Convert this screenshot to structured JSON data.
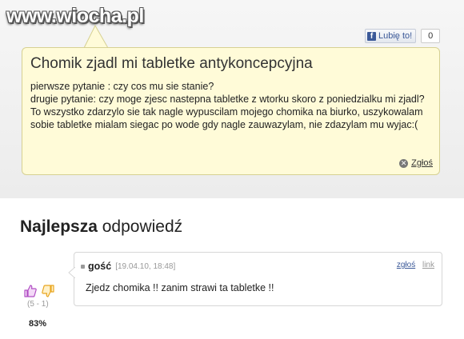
{
  "watermark": "www.wiocha.pl",
  "like": {
    "icon": "facebook-icon",
    "label": "Lubię to!",
    "count": "0"
  },
  "question": {
    "title": "Chomik zjadl mi tabletke antykoncepcyjna",
    "lines": [
      "pierwsze pytanie : czy cos mu sie stanie?",
      "drugie pytanie: czy moge zjesc nastepna tabletke z wtorku skoro z poniedzialku mi zjadl?",
      "To wszystko zdarzylo sie tak nagle wypuscilam mojego chomika na biurko, uszykowalam sobie tabletke mialam siegac po wode gdy nagle zauwazylam, nie zdazylam mu wyjac:("
    ],
    "report_label": "Zgłoś"
  },
  "best_answer": {
    "heading_bold": "Najlepsza",
    "heading_rest": " odpowiedź"
  },
  "answer": {
    "author": "gość",
    "date": "[19.04.10, 18:48]",
    "report_label": "zgłoś",
    "link_label": "link",
    "text": "Zjedz chomika !! zanim strawi ta tabletke !!",
    "votes": "(5 - 1)",
    "percent": "83%"
  },
  "colors": {
    "question_bg": "#fffbd8",
    "link": "#3b5998",
    "thumb_up": "#b14fc4",
    "thumb_down": "#e8a51e"
  }
}
